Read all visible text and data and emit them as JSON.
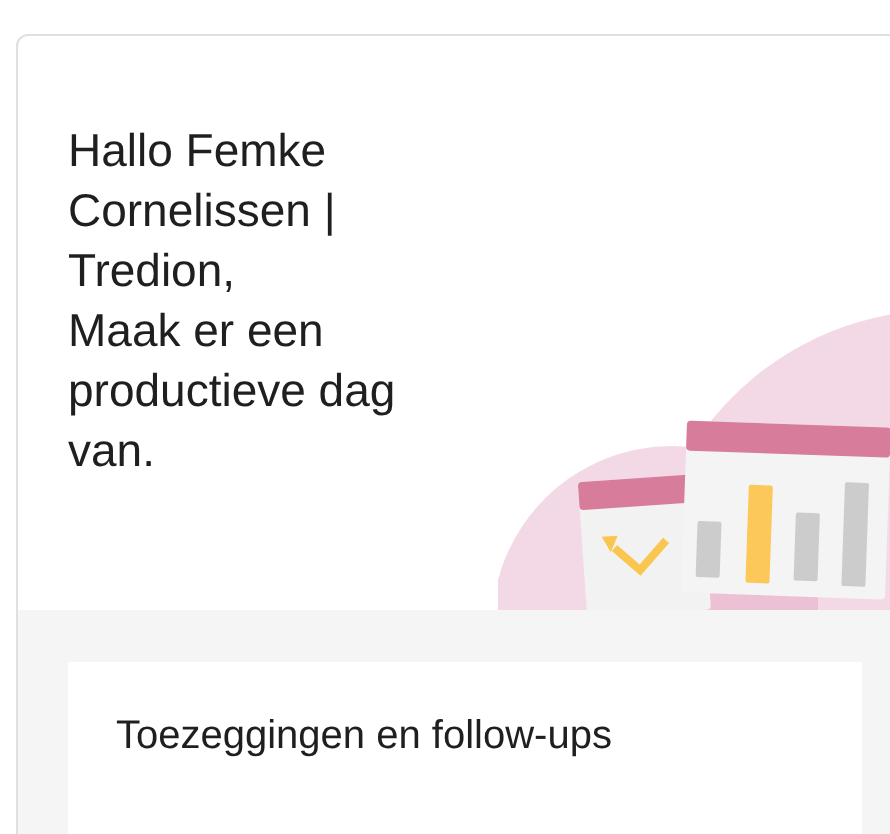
{
  "greeting": {
    "lines": [
      "Hallo Femke Cornelissen | Tredion,",
      "Maak er een productieve dag van."
    ]
  },
  "section": {
    "title": "Toezeggingen en follow-ups"
  }
}
